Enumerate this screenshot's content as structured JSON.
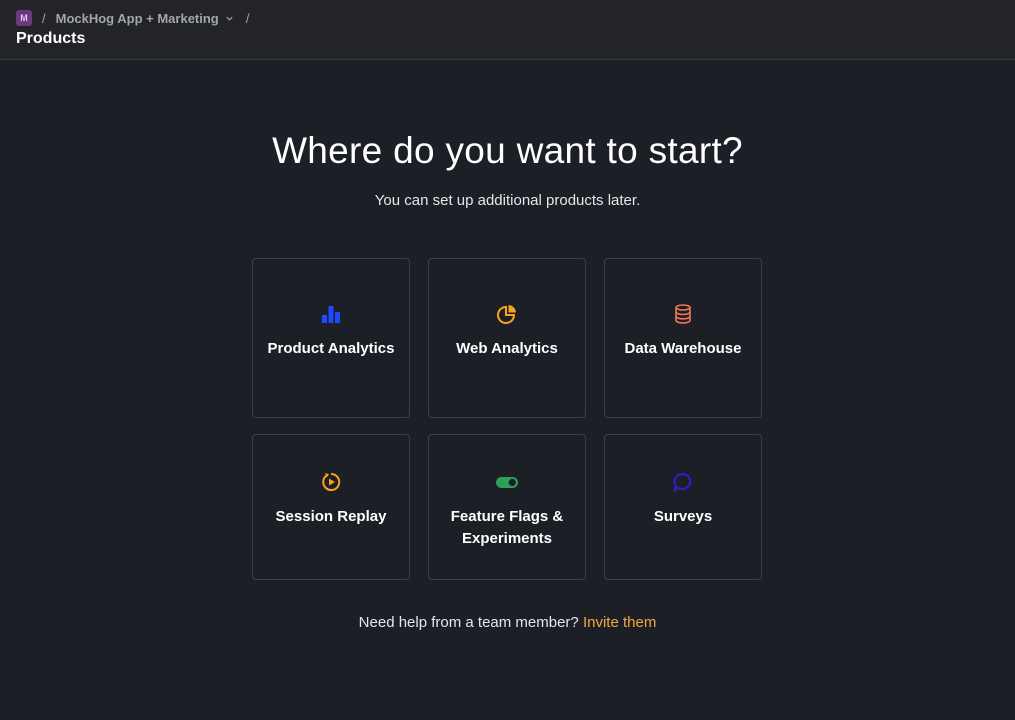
{
  "breadcrumb": {
    "org_initial": "M",
    "separator": "/",
    "project_name": "MockHog App + Marketing",
    "trailing_separator": "/"
  },
  "page_title": "Products",
  "main": {
    "heading": "Where do you want to start?",
    "subheading": "You can set up additional products later.",
    "products": [
      {
        "label": "Product Analytics",
        "icon": "bar-chart-icon",
        "color": "#1d4aff"
      },
      {
        "label": "Web Analytics",
        "icon": "pie-chart-icon",
        "color": "#f9a21a"
      },
      {
        "label": "Data Warehouse",
        "icon": "database-icon",
        "color": "#f0775a"
      },
      {
        "label": "Session Replay",
        "icon": "rewind-play-icon",
        "color": "#f9a21a"
      },
      {
        "label": "Feature Flags & Experiments",
        "icon": "toggle-icon",
        "color": "#2e9e5b"
      },
      {
        "label": "Surveys",
        "icon": "speech-bubble-icon",
        "color": "#2c1fd1"
      }
    ],
    "help_text": "Need help from a team member?",
    "invite_link": "Invite them",
    "accent_color": "#f3a83b"
  }
}
